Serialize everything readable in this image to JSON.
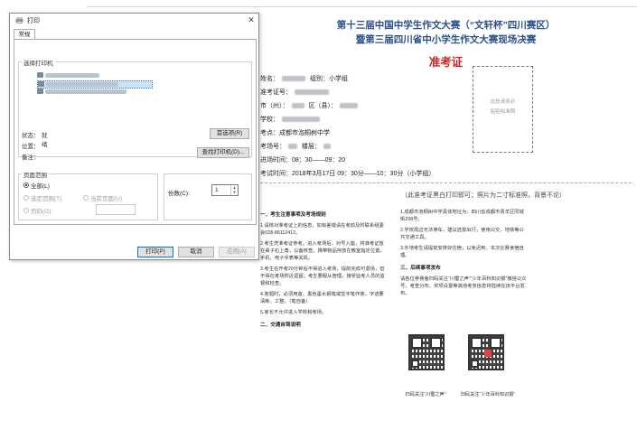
{
  "document": {
    "title_line1": "第十三届中国中学生作文大赛（“文轩杯”四川赛区）",
    "title_line2": "暨第三届四川省中小学生作文大赛现场决赛",
    "ticket_title": "准考证",
    "name_label": "姓名：",
    "group_label": "组别：小学组",
    "exam_no_label": "准考证号：",
    "city_label": "市（州）：",
    "district_label": "区（县）：",
    "school_label": "学校：",
    "venue": "考点：成都市泡桐树中学",
    "room_label": "考场号：",
    "floor_label": "楼层：",
    "entry_time": "进场时间：08：30——09：20",
    "exam_time": "考试时间：2018年3月17日 09：30分——10：30分（小学组）",
    "photo_line1": "此处请务必",
    "photo_line2": "粘贴标准照",
    "print_note": "（此准考证黑白打印即可；照片为二寸标准照，背景不论）",
    "left_col": {
      "heading1": "一、考生注意事项及考场规则",
      "p1": "1.请核对准考证上的信息，如有差错请在考前及时联系组委会028-86112412。",
      "p2": "2.考生凭准考证参考。进入考场后，对号入座，将准考证放在桌子右上角，以备核查。携带物品存放在教室指定位置，手机、电子手表等关机。",
      "p3": "3.考生在开考20分钟后不得进入考场，提前完成可退场，但不得在考场附近逗留；考生要服从管理，接受监考人员的监督和检查。",
      "p4": "4.答题时，必须用蓝、黑色墨水钢笔或签字笔作答，字迹要清晰、工整。（笔自备）",
      "p5": "5.家长不允许进入学校和考场。",
      "heading2": "二、交通自驾说明"
    },
    "right_col": {
      "p1": "1.成都市泡桐树中学具体地址为：四川省成都市青羊区同城街298号。",
      "p2": "2.学校周边无法停车，建议选拔出行，使用公交、地铁等公共交通工具。",
      "p3": "3.外地考生请提前安排好住宿，以免迟到，本次比赛食宿自理。",
      "heading3": "三、后续事项发布",
      "p4": "请各位参赛者扫码关注“川蜀之声”“少年百科知识报”微信公众号，考查分布、奖项设置等其他考务信息将陆续在该平台发布。"
    },
    "qr_caption1": "扫码关注“川蜀之声”",
    "qr_caption2": "扫码关注“少年百科知识报”"
  },
  "dialog": {
    "title": "打印",
    "close": "✕",
    "tab_general": "常规",
    "select_printer_label": "选择打印机",
    "status_label": "状态：",
    "status_value": "就绪",
    "location_label": "位置：",
    "comment_label": "备注：",
    "preferences_button": "首选项(R)",
    "find_printer_button": "查找打印机(D)...",
    "page_range_label": "页面范围",
    "range_all": "全部(L)",
    "range_selection": "选定范围(T)",
    "range_current": "当前页面(U)",
    "range_pages": "页码(G):",
    "copies_label": "份数(C):",
    "copies_value": "1",
    "print_button": "打印(P)",
    "cancel_button": "取消",
    "apply_button": "应用(A)"
  }
}
